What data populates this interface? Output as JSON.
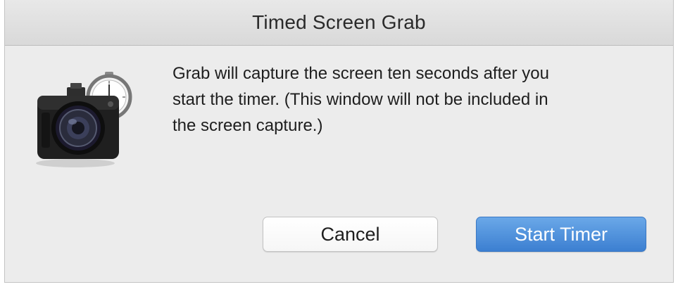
{
  "window": {
    "title": "Timed Screen Grab"
  },
  "dialog": {
    "icon": "camera-timer-icon",
    "message": "Grab will capture the screen ten seconds after you\nstart the timer.  (This window will not be included in\nthe screen capture.)"
  },
  "buttons": {
    "cancel_label": "Cancel",
    "start_label": "Start Timer"
  },
  "colors": {
    "primary_button": "#4a8fdd",
    "window_background": "#ececec"
  }
}
